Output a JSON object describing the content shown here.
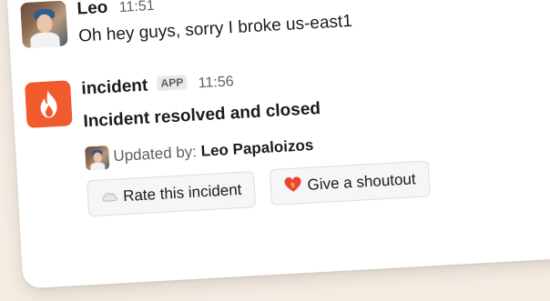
{
  "messages": [
    {
      "author": "Leo",
      "time": "11:51",
      "text": "Oh hey guys, sorry I broke us-east1"
    }
  ],
  "incident": {
    "author": "incident",
    "badge": "APP",
    "time": "11:56",
    "title": "Incident resolved and closed",
    "updated_label": "Updated by:",
    "updated_by": "Leo Papaloizos",
    "buttons": {
      "rate": "Rate this incident",
      "shoutout": "Give a shoutout"
    }
  },
  "colors": {
    "brand": "#f05a2c",
    "background": "#f4ede4"
  },
  "icons": {
    "incident_logo": "flame-icon",
    "rate": "cloud-icon",
    "shoutout": "heart-fire-icon"
  }
}
